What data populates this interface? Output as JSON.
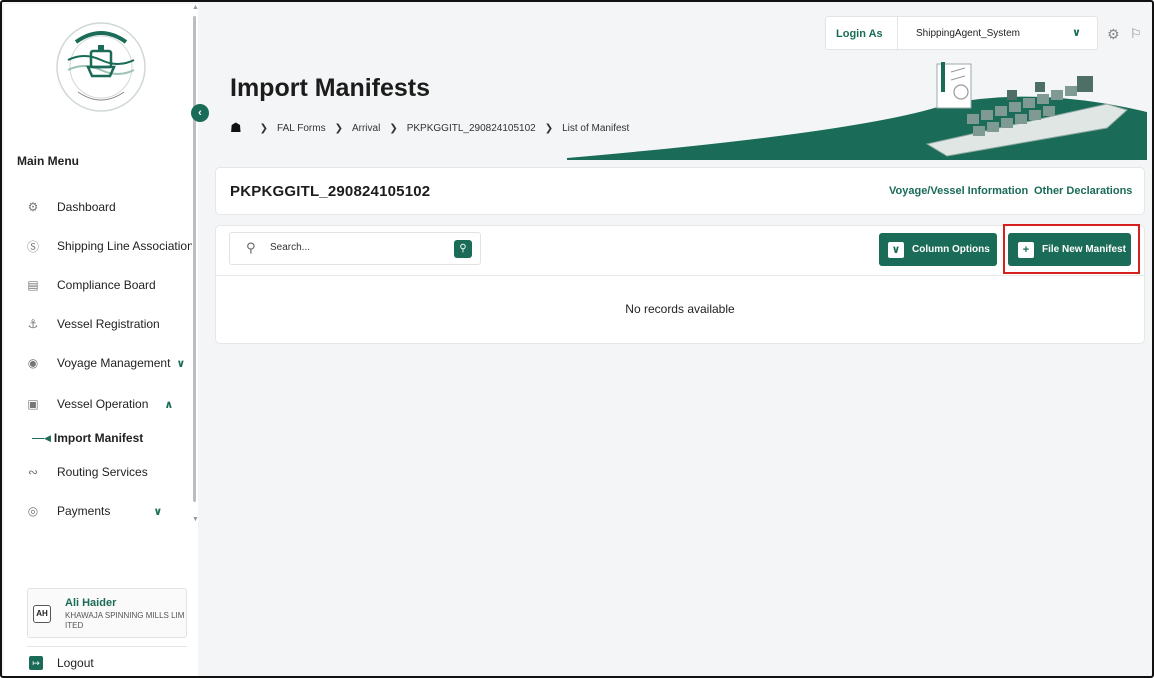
{
  "sidebar": {
    "main_menu_label": "Main Menu",
    "items": [
      {
        "label": "Dashboard",
        "icon": "dashboard-icon"
      },
      {
        "label": "Shipping Line Association",
        "icon": "association-icon"
      },
      {
        "label": "Compliance Board",
        "icon": "document-icon"
      },
      {
        "label": "Vessel Registration",
        "icon": "ship-icon"
      },
      {
        "label": "Voyage Management",
        "icon": "location-icon",
        "expand": "chevron-down"
      },
      {
        "label": "Vessel Operation",
        "icon": "cargo-icon",
        "expand": "chevron-up"
      },
      {
        "label": "Routing Services",
        "icon": "route-icon"
      },
      {
        "label": "Payments",
        "icon": "payment-icon",
        "expand": "chevron-down"
      }
    ],
    "active_sub_item": "Import Manifest",
    "user": {
      "initials": "AH",
      "name": "Ali Haider",
      "org": "KHAWAJA SPINNING MILLS LIMITED"
    },
    "logout_label": "Logout"
  },
  "topbar": {
    "login_as_label": "Login As",
    "selected_user": "ShippingAgent_System"
  },
  "header": {
    "title": "Import Manifests",
    "breadcrumb": [
      "FAL Forms",
      "Arrival",
      "PKPKGGITL_290824105102",
      "List of Manifest"
    ]
  },
  "manifest": {
    "id": "PKPKGGITL_290824105102",
    "links": [
      "Voyage/Vessel Information",
      "Other Declarations"
    ]
  },
  "toolbar": {
    "search_placeholder": "Search...",
    "column_options_label": "Column Options",
    "file_new_label": "File New Manifest"
  },
  "table": {
    "empty_message": "No records available"
  },
  "colors": {
    "accent": "#1a6b57",
    "highlight": "#d62020"
  }
}
